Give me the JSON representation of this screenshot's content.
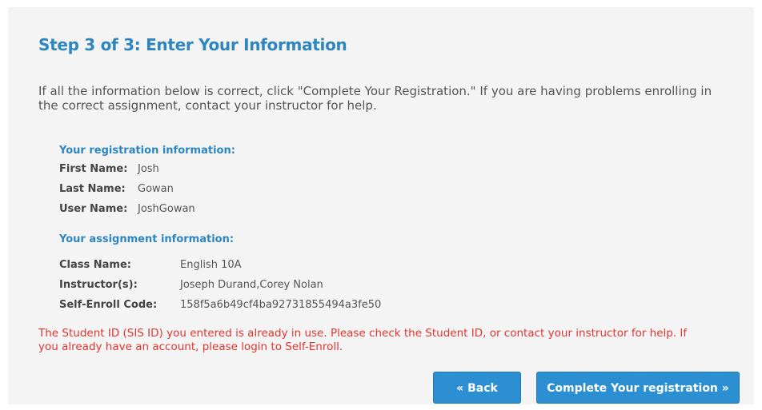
{
  "header": {
    "title": "Step 3 of 3: Enter Your Information"
  },
  "intro": {
    "text": "If all the information below is correct, click \"Complete Your Registration.\" If you are having problems enrolling in the correct assignment, contact your instructor for help."
  },
  "registration": {
    "heading": "Your registration information:",
    "rows": [
      {
        "label": "First Name:",
        "value": "Josh"
      },
      {
        "label": "Last Name:",
        "value": "Gowan"
      },
      {
        "label": "User Name:",
        "value": "JoshGowan"
      }
    ]
  },
  "assignment": {
    "heading": "Your assignment information:",
    "rows": [
      {
        "label": "Class Name:",
        "value": "English 10A"
      },
      {
        "label": "Instructor(s):",
        "value": "Joseph Durand,Corey Nolan"
      },
      {
        "label": "Self-Enroll Code:",
        "value": "158f5a6b49cf4ba92731855494a3fe50"
      }
    ]
  },
  "error": {
    "text": "The Student ID (SIS ID) you entered is already in use. Please check the Student ID, or contact your instructor for help. If you already have an account, please login to Self-Enroll."
  },
  "actions": {
    "back_label": "« Back",
    "complete_label": "Complete Your registration »"
  },
  "colors": {
    "accent": "#2e86c1",
    "error": "#e2352f",
    "button": "#2b8fd1",
    "panel_background": "#f4f4f4"
  }
}
